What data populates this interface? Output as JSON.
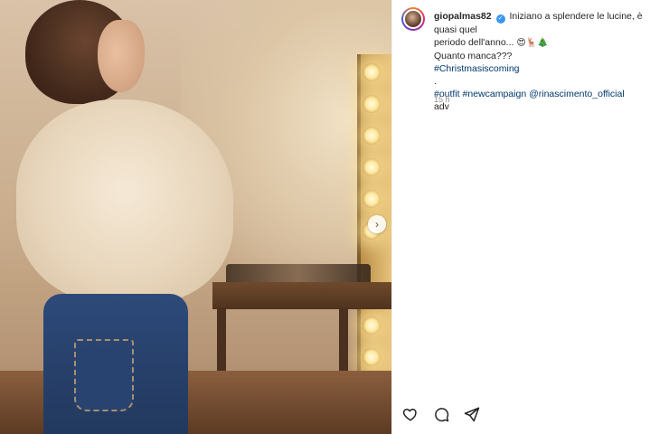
{
  "post": {
    "username": "giopalmas82",
    "caption_line1": "Iniziano a splendere le lucine, è quasi quel",
    "caption_line2": "periodo dell'anno...",
    "caption_emojis": "😍🦌🎄",
    "caption_line3": "Quanto manca???",
    "hashtag_christmas": "#Christmasiscoming",
    "dot_line": ".",
    "tag_outfit": "#outfit",
    "tag_newcampaign": "#newcampaign",
    "tag_brand": "@rinascimento_official",
    "adv": "adv",
    "timestamp": "15 h"
  },
  "icons": {
    "verified": "verified-badge-icon",
    "like": "heart-icon",
    "comment": "comment-icon",
    "share": "send-icon",
    "next": "chevron-right-icon"
  },
  "colors": {
    "link": "#00376b",
    "verified": "#3897f0",
    "muted": "#8e8e8e"
  }
}
